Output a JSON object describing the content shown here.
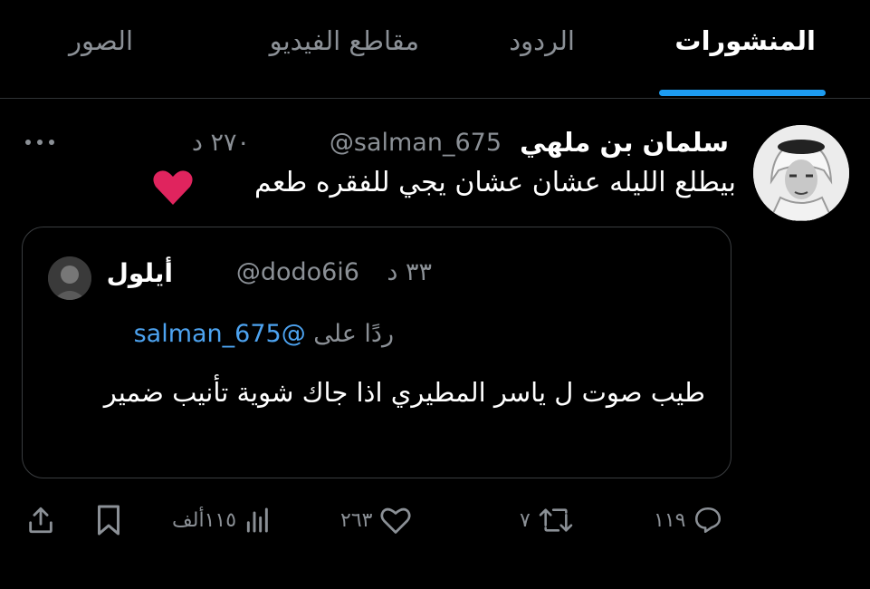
{
  "tabs": [
    {
      "label": "المنشورات",
      "active": true
    },
    {
      "label": "الردود",
      "active": false
    },
    {
      "label": "مقاطع الفيديو",
      "active": false
    },
    {
      "label": "الصور",
      "active": false
    }
  ],
  "tweet": {
    "display_name": "سلمان بن ملهي",
    "handle": "@salman_675",
    "time": "٢٧٠ د",
    "text": "بيطلع الليله عشان عشان يجي للفقره طعم",
    "emoji": "heart-emoji",
    "more_icon": "more-icon"
  },
  "quote": {
    "display_name": "أيلول",
    "handle": "@dodo6i6",
    "time": "٣٣ د",
    "reply_prefix": "ردًا على",
    "reply_to": "@salman_675",
    "text": "طيب صوت ل ياسر المطيري اذا جاك شوية تأنيب ضمير"
  },
  "actions": {
    "replies": "١١٩",
    "retweets": "٧",
    "likes": "٢٦٣",
    "views": "١١٥ألف",
    "icons": [
      "reply-icon",
      "retweet-icon",
      "like-icon",
      "views-icon",
      "bookmark-icon",
      "share-icon"
    ]
  },
  "colors": {
    "accent": "#1d9bf0",
    "muted": "#8b9096",
    "heart": "#e0245e"
  }
}
